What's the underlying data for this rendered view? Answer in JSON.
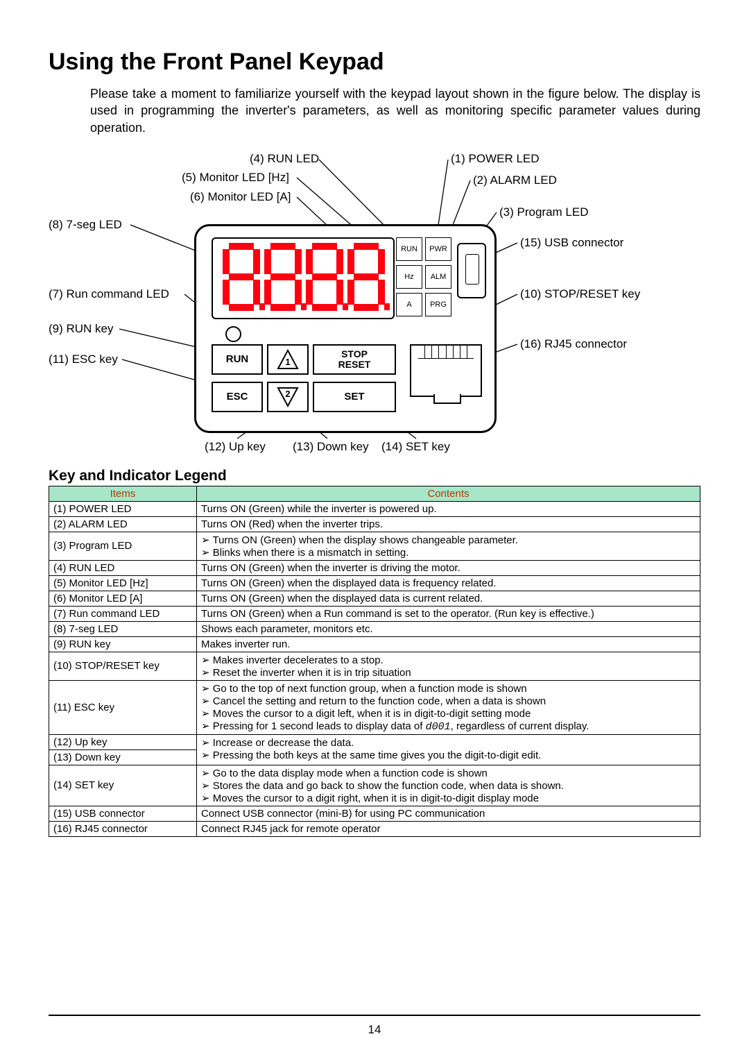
{
  "title": "Using the Front Panel Keypad",
  "intro": "Please take a moment to familiarize yourself with the keypad layout shown in the figure below. The display is used in programming the inverter's parameters, as well as monitoring specific parameter values during operation.",
  "status_boxes": {
    "row1": [
      "RUN",
      "PWR"
    ],
    "row2": [
      "Hz",
      "ALM"
    ],
    "row3": [
      "A",
      "PRG"
    ]
  },
  "buttons": {
    "run": "RUN",
    "up": "1",
    "stop_reset_line1": "STOP",
    "stop_reset_line2": "RESET",
    "esc": "ESC",
    "down": "2",
    "set": "SET"
  },
  "callouts": {
    "c1": "(1) POWER LED",
    "c2": "(2) ALARM LED",
    "c3": "(3) Program LED",
    "c4": "(4) RUN LED",
    "c5": "(5) Monitor LED [Hz]",
    "c6": "(6) Monitor LED [A]",
    "c7": "(7) Run command LED",
    "c8": "(8) 7-seg LED",
    "c9": "(9) RUN key",
    "c10": "(10) STOP/RESET key",
    "c11": "(11) ESC key",
    "c12": "(12) Up key",
    "c13": "(13) Down key",
    "c14": "(14) SET key",
    "c15": "(15) USB connector",
    "c16": "(16) RJ45 connector"
  },
  "legend_title": "Key and Indicator Legend",
  "table_headers": [
    "Items",
    "Contents"
  ],
  "legend": [
    {
      "item": "(1) POWER LED",
      "text": "Turns ON (Green) while the inverter is powered up."
    },
    {
      "item": "(2) ALARM LED",
      "text": "Turns ON (Red) when the inverter trips."
    },
    {
      "item": "(3) Program LED",
      "bullets": [
        "Turns ON (Green) when the display shows changeable parameter.",
        "Blinks when there is a mismatch in setting."
      ]
    },
    {
      "item": "(4) RUN LED",
      "text": "Turns ON (Green) when the inverter is driving the motor."
    },
    {
      "item": "(5) Monitor LED [Hz]",
      "text": "Turns ON (Green) when the displayed data is frequency related."
    },
    {
      "item": "(6) Monitor LED [A]",
      "text": "Turns ON (Green) when the displayed data is current related."
    },
    {
      "item": "(7) Run command LED",
      "text": "Turns ON (Green) when a Run command is set to the operator. (Run key is effective.)"
    },
    {
      "item": "(8) 7-seg LED",
      "text": "Shows each parameter, monitors etc."
    },
    {
      "item": "(9) RUN key",
      "text": "Makes inverter run."
    },
    {
      "item": "(10) STOP/RESET key",
      "bullets": [
        "Makes inverter decelerates to a stop.",
        "Reset the inverter when it is in trip situation"
      ]
    },
    {
      "item": "(11) ESC key",
      "bullets": [
        "Go to the top of next function group, when a function mode is shown",
        "Cancel the setting and return to the function code, when a data is shown",
        "Moves the cursor to a digit left, when it is in digit-to-digit setting mode",
        "Pressing for 1 second leads to display data of d001, regardless of current display."
      ]
    },
    {
      "item": "(12) Up key",
      "bullets": [
        "Increase or decrease the data."
      ],
      "rowspan_with_next": true
    },
    {
      "item": "(13) Down key",
      "bullets": [
        "Pressing the both keys at the same time gives you the digit-to-digit edit."
      ]
    },
    {
      "item": "(14) SET key",
      "bullets": [
        "Go to the data display mode when a function code is shown",
        "Stores the data and go back to show the function code, when data is shown.",
        "Moves the cursor to a digit right, when it is in digit-to-digit display mode"
      ]
    },
    {
      "item": "(15) USB connector",
      "text": "Connect USB connector (mini-B) for using PC communication"
    },
    {
      "item": "(16) RJ45 connector",
      "text": "Connect RJ45 jack for remote operator"
    }
  ],
  "page_number": "14",
  "d001_code": "d001"
}
